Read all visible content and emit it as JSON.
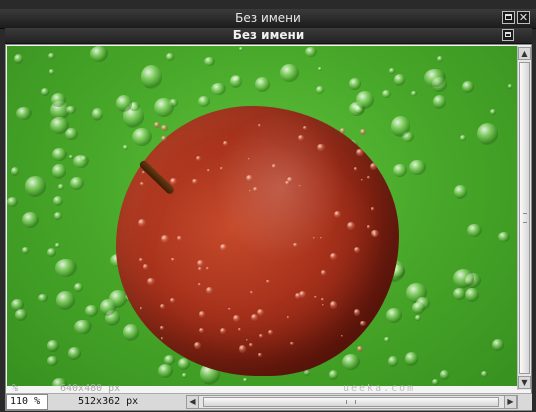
{
  "window": {
    "title": "Без имени",
    "maximize_icon": "maximize-icon",
    "close_icon": "close-icon",
    "close_glyph": "✕"
  },
  "document": {
    "title": "Без имени",
    "maximize_icon": "maximize-icon"
  },
  "canvas": {
    "image_subject": "red apple on green background with water drops",
    "colors": {
      "background": "#49a92a",
      "apple": "#a8321c"
    }
  },
  "status": {
    "zoom": "110 %",
    "dimensions": "512x362 px",
    "ghost_zoom": "%",
    "ghost_dimensions": "640x480 px",
    "watermark": "ueeka.com"
  },
  "scrollbars": {
    "up_glyph": "▲",
    "down_glyph": "▼",
    "left_glyph": "◀",
    "right_glyph": "▶"
  }
}
